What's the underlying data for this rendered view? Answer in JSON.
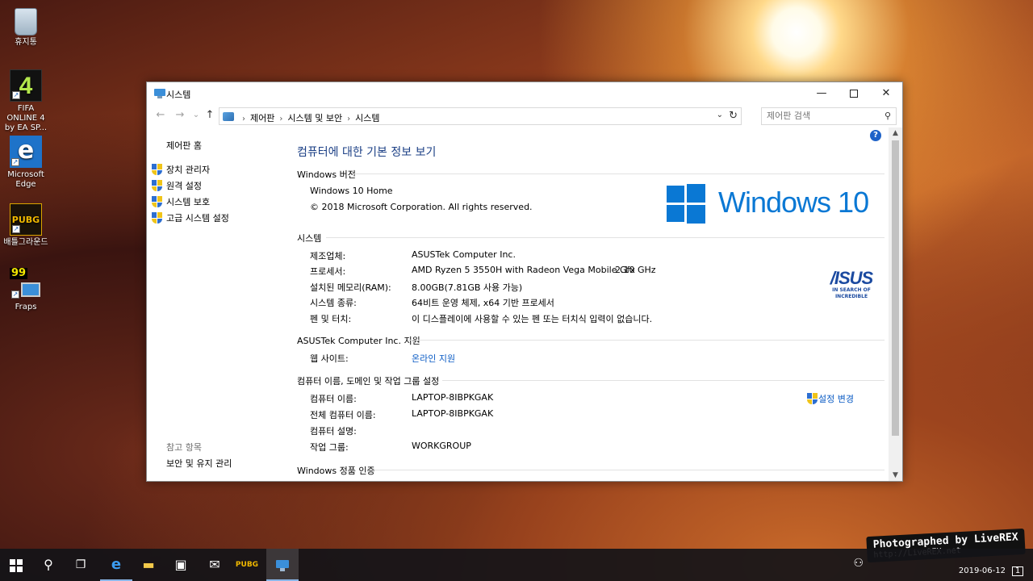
{
  "desktop": {
    "icons": [
      {
        "label": "휴지통"
      },
      {
        "label": "FIFA ONLINE 4 by EA SP...",
        "glyph": "4"
      },
      {
        "label": "Microsoft Edge",
        "glyph": "e"
      },
      {
        "label": "배틀그라운드",
        "glyph": "PUBG"
      },
      {
        "label": "Fraps",
        "glyph": "99"
      }
    ]
  },
  "window": {
    "title": "시스템",
    "controls": {
      "minimize": "—",
      "close": "✕"
    },
    "nav": {
      "back": "←",
      "forward": "→",
      "recent": "⌄",
      "up": "↑"
    },
    "breadcrumbs": [
      "제어판",
      "시스템 및 보안",
      "시스템"
    ],
    "search_placeholder": "제어판 검색"
  },
  "left_pane": {
    "home": "제어판 홈",
    "links": [
      "장치 관리자",
      "원격 설정",
      "시스템 보호",
      "고급 시스템 설정"
    ],
    "see_also_title": "참고 항목",
    "see_also_links": [
      "보안 및 유지 관리"
    ]
  },
  "main": {
    "heading": "컴퓨터에 대한 기본 정보 보기",
    "edition": {
      "section": "Windows 버전",
      "name": "Windows 10 Home",
      "copyright": "© 2018 Microsoft Corporation. All rights reserved.",
      "logo_text": "Windows 10"
    },
    "system": {
      "section": "시스템",
      "rows": [
        {
          "label": "제조업체:",
          "value": "ASUSTek Computer Inc."
        },
        {
          "label": "프로세서:",
          "value": "AMD Ryzen 5 3550H with Radeon Vega Mobile Gfx",
          "extra": "2.10 GHz"
        },
        {
          "label": "설치된 메모리(RAM):",
          "value": "8.00GB(7.81GB 사용 가능)"
        },
        {
          "label": "시스템 종류:",
          "value": "64비트 운영 체제, x64 기반 프로세서"
        },
        {
          "label": "펜 및 터치:",
          "value": "이 디스플레이에 사용할 수 있는 펜 또는 터치식 입력이 없습니다."
        }
      ],
      "oem_logo": "/ISUS",
      "oem_tagline": "IN SEARCH OF INCREDIBLE"
    },
    "support": {
      "section": "ASUSTek Computer Inc. 지원",
      "rows": [
        {
          "label": "웹 사이트:",
          "value": "온라인 지원"
        }
      ]
    },
    "computer_name": {
      "section": "컴퓨터 이름, 도메인 및 작업 그룹 설정",
      "rows": [
        {
          "label": "컴퓨터 이름:",
          "value": "LAPTOP-8IBPKGAK"
        },
        {
          "label": "전체 컴퓨터 이름:",
          "value": "LAPTOP-8IBPKGAK"
        },
        {
          "label": "컴퓨터 설명:",
          "value": ""
        },
        {
          "label": "작업 그룹:",
          "value": "WORKGROUP"
        }
      ],
      "change_settings": "설정 변경"
    },
    "activation": {
      "section": "Windows 정품 인증"
    }
  },
  "taskbar": {
    "date": "2019-06-12",
    "pubg_label": "PUBG",
    "notification_count": "1"
  },
  "watermark": {
    "line1": "Photographed by LiveREX",
    "line2": "http://LiveREX.net"
  },
  "colors": {
    "accent": "#0a78d4",
    "link": "#0a5bc4",
    "heading": "#1b3f85"
  }
}
